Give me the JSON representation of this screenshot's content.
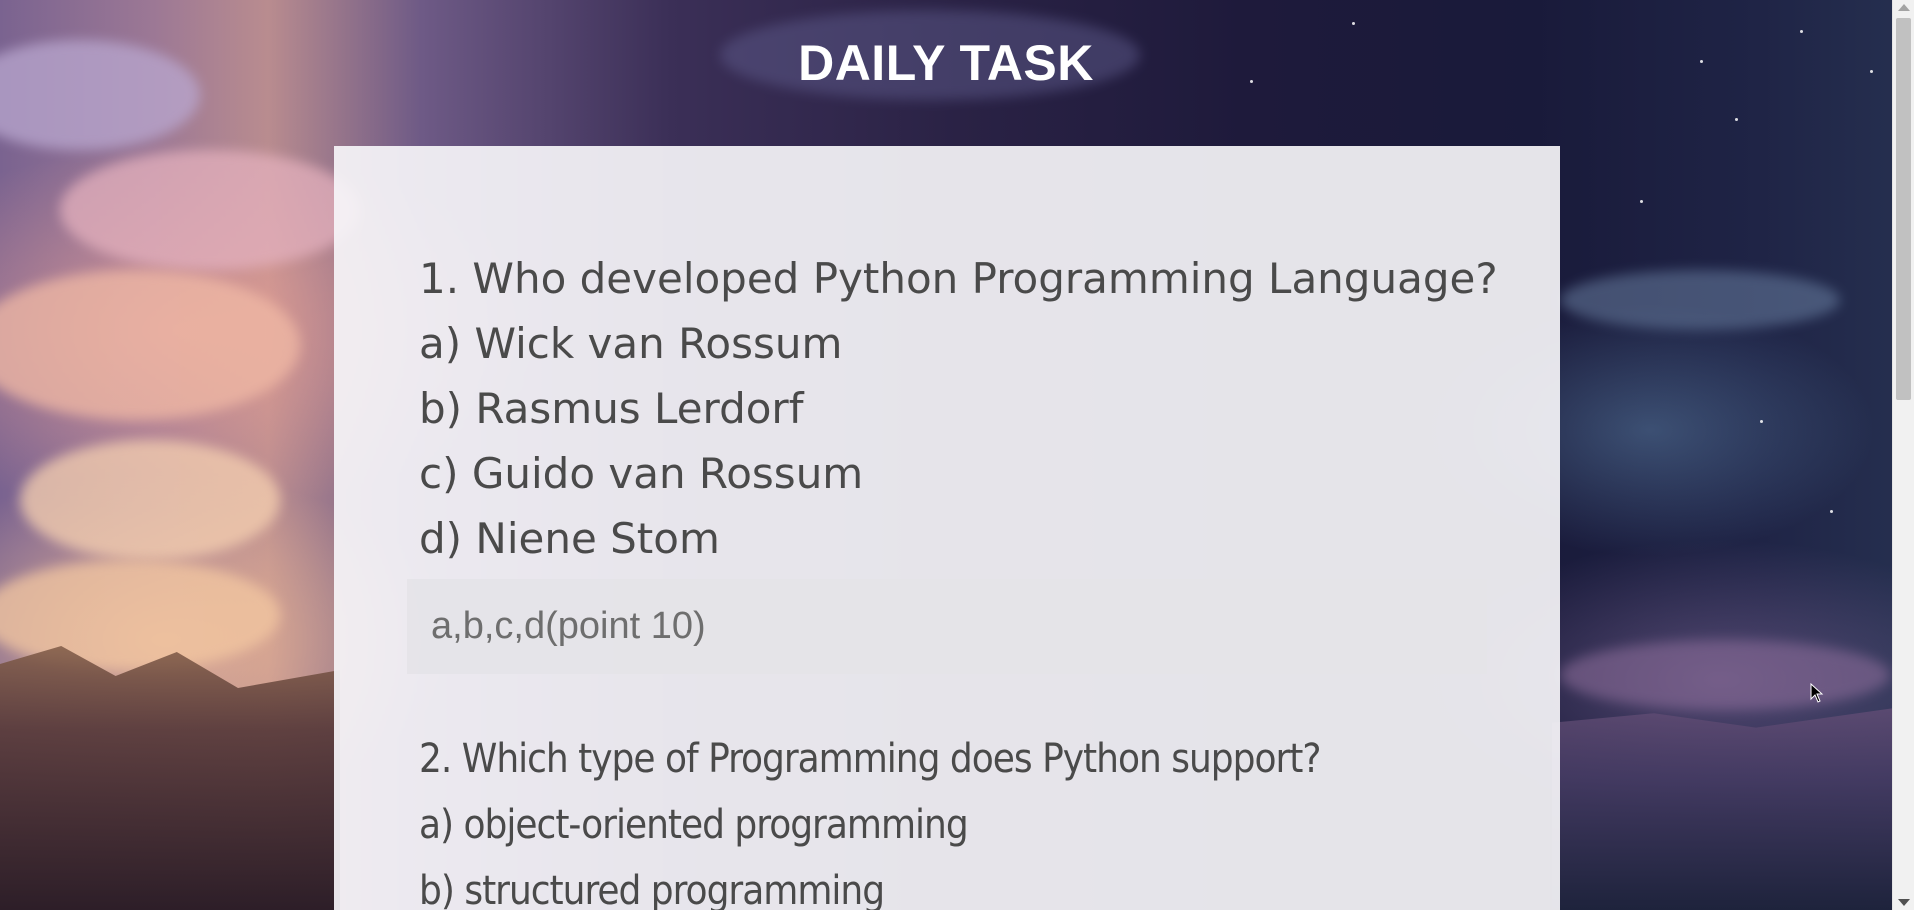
{
  "page": {
    "title": "DAILY TASK"
  },
  "questions": [
    {
      "text": "1. Who developed Python Programming Language?",
      "options": [
        "a) Wick van Rossum",
        "b) Rasmus Lerdorf",
        "c) Guido van Rossum",
        "d) Niene Stom"
      ],
      "answer_placeholder": "a,b,c,d(point 10)",
      "answer_value": ""
    },
    {
      "text": "2. Which type of Programming does Python support?",
      "options": [
        "a) object-oriented programming",
        "b) structured programming"
      ]
    }
  ],
  "colors": {
    "title_text": "#ffffff",
    "card_background": "#f6f5f9",
    "question_text": "#4a4a4a",
    "input_background": "#e4e3e8"
  },
  "icons": {
    "cursor": "mouse-pointer-icon"
  }
}
